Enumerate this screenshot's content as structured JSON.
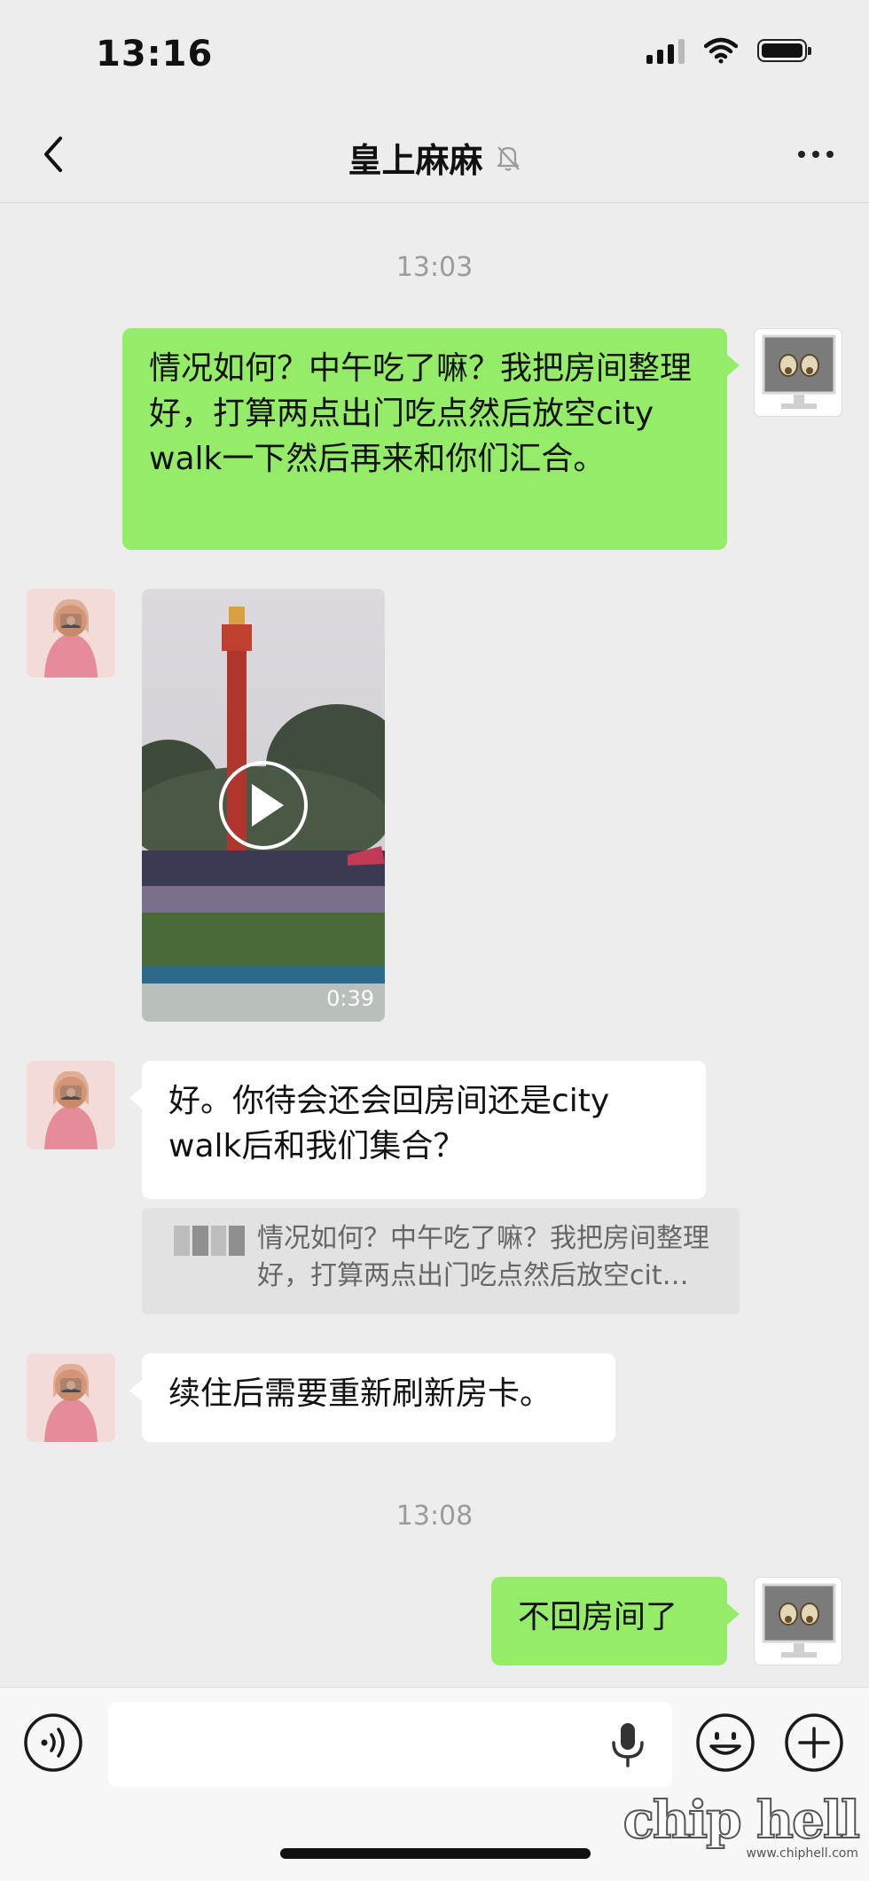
{
  "status_bar": {
    "time": "13:16"
  },
  "header": {
    "title": "皇上麻麻"
  },
  "messages": [
    {
      "type": "timestamp",
      "text": "13:03"
    },
    {
      "type": "text",
      "sender": "me",
      "text": "情况如何？中午吃了嘛？我把房间整理好，打算两点出门吃点然后放空city walk一下然后再来和你们汇合。"
    },
    {
      "type": "video",
      "sender": "other",
      "duration": "0:39"
    },
    {
      "type": "text",
      "sender": "other",
      "text": "好。你待会还会回房间还是city walk后和我们集合？"
    },
    {
      "type": "quote",
      "text": "情况如何？中午吃了嘛？我把房间整理好，打算两点出门吃点然后放空cit…"
    },
    {
      "type": "text",
      "sender": "other",
      "text": "续住后需要重新刷新房卡。"
    },
    {
      "type": "timestamp",
      "text": "13:08"
    },
    {
      "type": "text",
      "sender": "me",
      "text": "不回房间了"
    }
  ],
  "watermark": {
    "logo": "chip hell",
    "url": "www.chiphell.com"
  },
  "colors": {
    "my_bubble": "#95ec69",
    "other_bubble": "#ffffff",
    "background": "#ededed"
  }
}
